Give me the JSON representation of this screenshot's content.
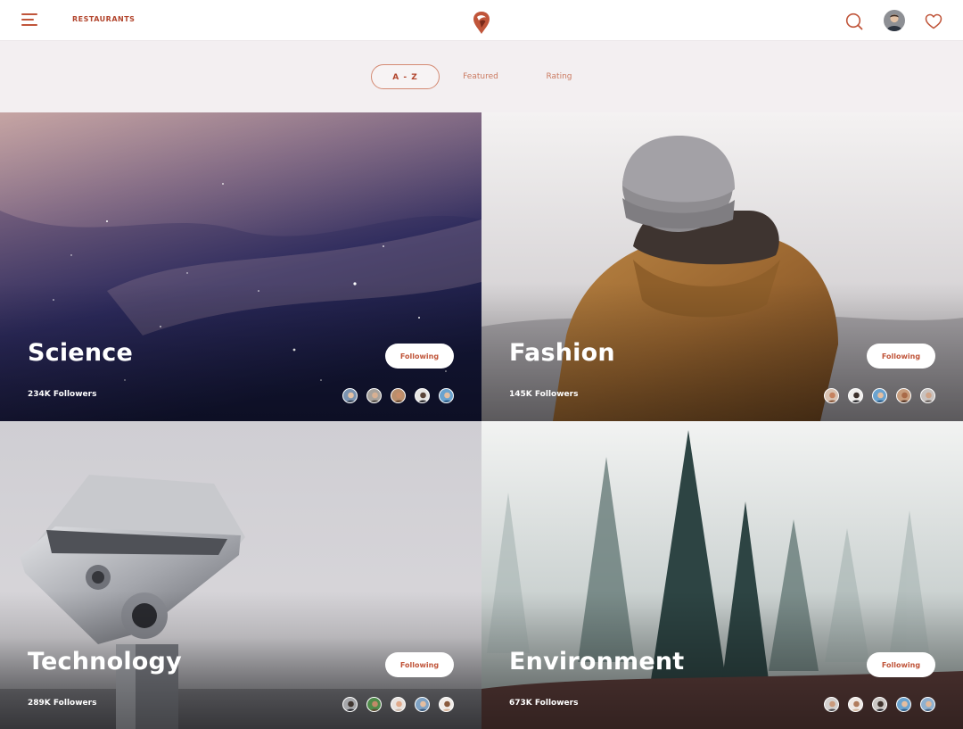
{
  "header": {
    "brand_link": "RESTAURANTS",
    "accent_color": "#c0553a"
  },
  "sort_tabs": [
    {
      "label": "A - Z",
      "active": true
    },
    {
      "label": "Featured",
      "active": false
    },
    {
      "label": "Rating",
      "active": false
    }
  ],
  "cards": [
    {
      "title": "Science",
      "followers": "234K Followers",
      "button": "Following",
      "image": "starry-sky-photo"
    },
    {
      "title": "Fashion",
      "followers": "145K Followers",
      "button": "Following",
      "image": "person-in-beanie-photo"
    },
    {
      "title": "Technology",
      "followers": "289K Followers",
      "button": "Following",
      "image": "tower-viewer-binoculars-photo"
    },
    {
      "title": "Environment",
      "followers": "673K Followers",
      "button": "Following",
      "image": "foggy-pine-forest-photo"
    }
  ],
  "icons": {
    "menu": "hamburger-icon",
    "logo": "pin-logo-icon",
    "search": "search-icon",
    "favorites": "heart-icon"
  }
}
